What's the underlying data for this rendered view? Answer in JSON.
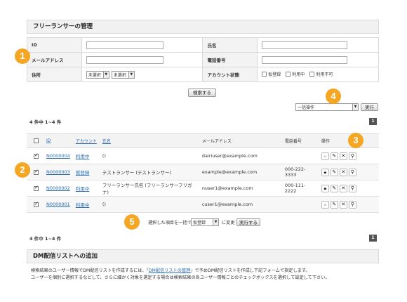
{
  "header": {
    "title": "フリーランサーの管理"
  },
  "search": {
    "id_label": "ID",
    "name_label": "氏名",
    "email_label": "メールアドレス",
    "phone_label": "電話番号",
    "address_label": "住所",
    "pref_value": "未選択",
    "city_value": "未選択",
    "status_label": "アカウント状態",
    "status_options": [
      "仮登録",
      "利用中",
      "利用不可"
    ],
    "submit_label": "検索する"
  },
  "bulk": {
    "select_value": "一括操作",
    "run_label": "実行"
  },
  "count_text": "4 件中 1~4 件",
  "page_number": "1",
  "table": {
    "headers": {
      "id": "ID",
      "account": "アカウント",
      "name": "氏名",
      "email": "メールアドレス",
      "phone": "電話番号",
      "ops": "操作"
    },
    "rows": [
      {
        "id": "N0000004",
        "status": "利用中",
        "name": "()",
        "email": "dairiuser@example.com",
        "phone": "",
        "checked": true
      },
      {
        "id": "N0000003",
        "status": "仮登録",
        "name": "テストランサー (テストランサー)",
        "email": "example@example.com",
        "phone": "000-222-3333",
        "checked": true
      },
      {
        "id": "N0000002",
        "status": "利用中",
        "name": "フリーランサー氏名 (フリーランサーフリガナ)",
        "email": "nuser1@example.com",
        "phone": "000-111-2222",
        "checked": true
      },
      {
        "id": "N0000001",
        "status": "利用中",
        "name": "()",
        "email": "cuser1@example.com",
        "phone": "",
        "checked": true
      }
    ]
  },
  "change": {
    "prefix": "選択した項目を一括で",
    "select_value": "仮登録",
    "suffix": "に変更",
    "run_label": "実行する"
  },
  "dm": {
    "title": "DM配信リストへの追加",
    "line1_a": "検索結果のユーザー情報でDM配信リストを作成するには、「",
    "line1_link": "DM配信リストの管理",
    "line1_b": "」で予めDM配信リストを作成し下記フォームで指定します。",
    "line2": "ユーザーを個別に選択するなどして、さらに細かく対象を選定する場合は検索結果の各ユーザー情報ごとのチェックボックスを選択して設定して下さい。"
  },
  "badges": [
    "1",
    "2",
    "3",
    "4",
    "5"
  ],
  "colors": {
    "badge": "#f5a623",
    "link": "#2a6db3",
    "header_bg": "#f1f1f1"
  }
}
